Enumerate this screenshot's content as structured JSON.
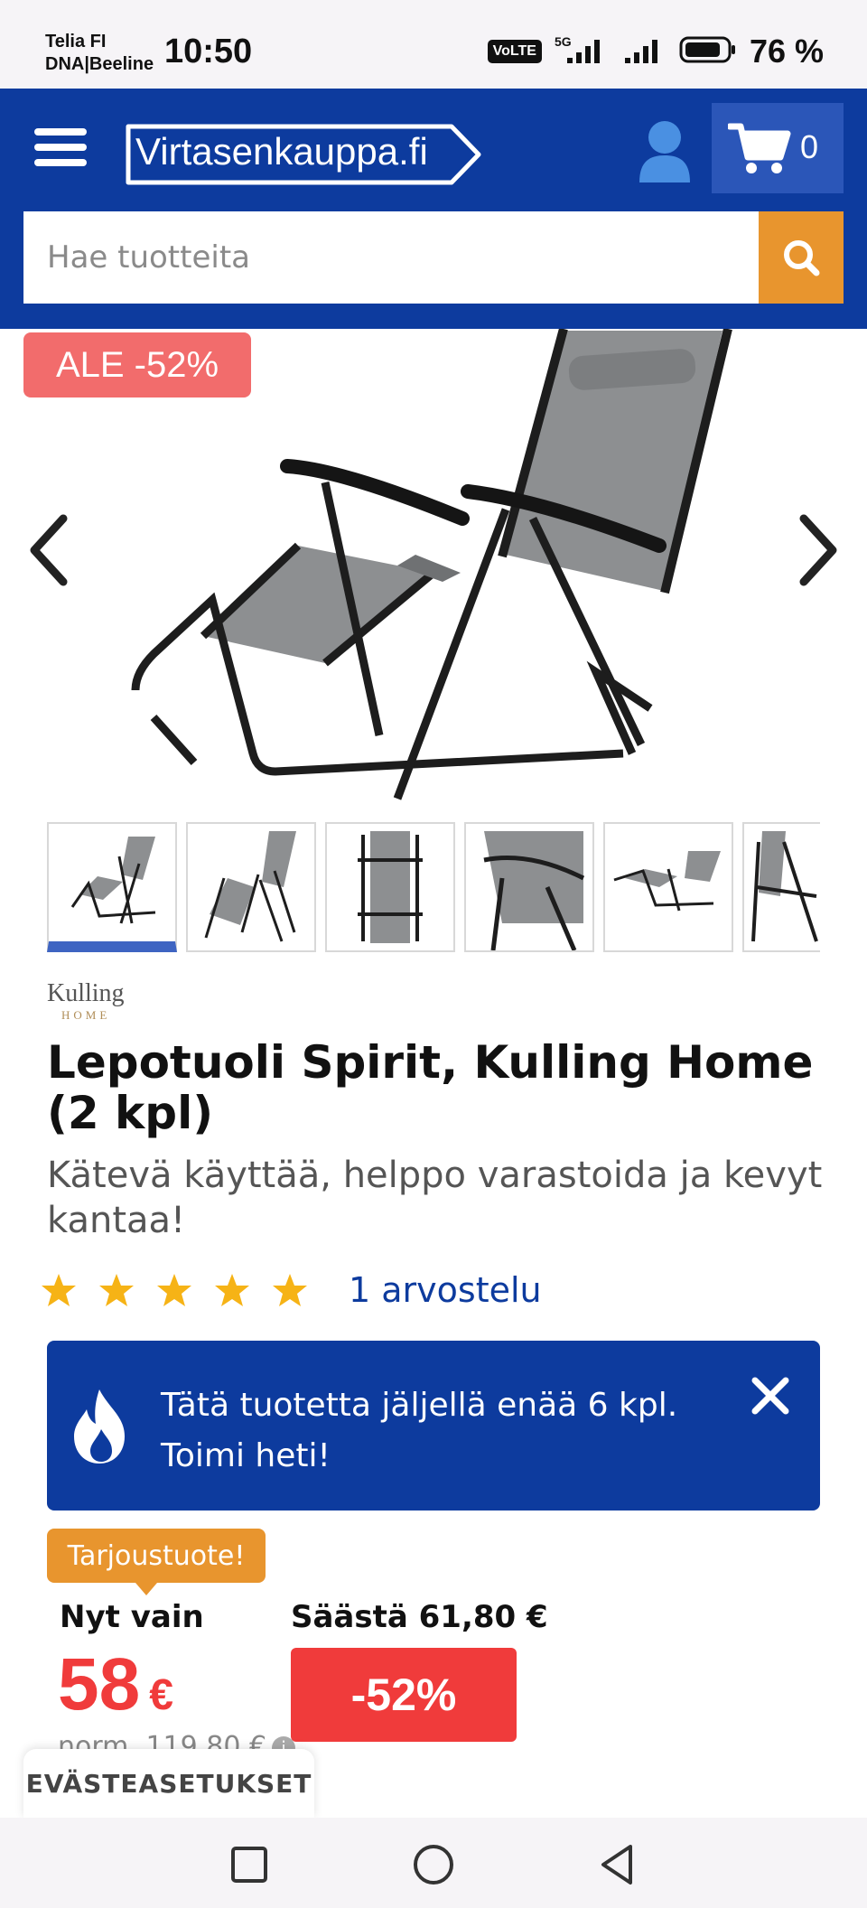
{
  "status_bar": {
    "carrier_line1": "Telia FI",
    "carrier_line2": "DNA|Beeline",
    "time": "10:50",
    "volte": "VoLTE",
    "network": "5G",
    "battery": "76 %"
  },
  "header": {
    "logo_text": "Virtasenkauppa.fi",
    "cart_count": "0",
    "search_placeholder": "Hae tuotteita",
    "colors": {
      "header_bg": "#0d3b9e",
      "accent": "#e8952e"
    }
  },
  "gallery": {
    "sale_badge": "ALE -52%",
    "thumbnail_count": 6,
    "active_thumbnail": 1
  },
  "product": {
    "brand_name": "Kulling",
    "brand_sub": "HOME",
    "title": "Lepotuoli Spirit, Kulling Home (2 kpl)",
    "subtitle": "Kätevä käyttää, helppo varastoida ja kevyt kantaa!",
    "rating_stars": 5,
    "reviews_link": "1 arvostelu"
  },
  "stock_banner": {
    "line1": "Tätä tuotetta jäljellä enää 6 kpl.",
    "line2": "Toimi heti!"
  },
  "pricing": {
    "offer_tag": "Tarjoustuote!",
    "now_label": "Nyt vain",
    "price": "58",
    "currency": "€",
    "save_label": "Säästä 61,80 €",
    "discount": "-52%",
    "normal_price": "norm. 119,80 €"
  },
  "cookie_settings": "EVÄSTEASETUKSET"
}
